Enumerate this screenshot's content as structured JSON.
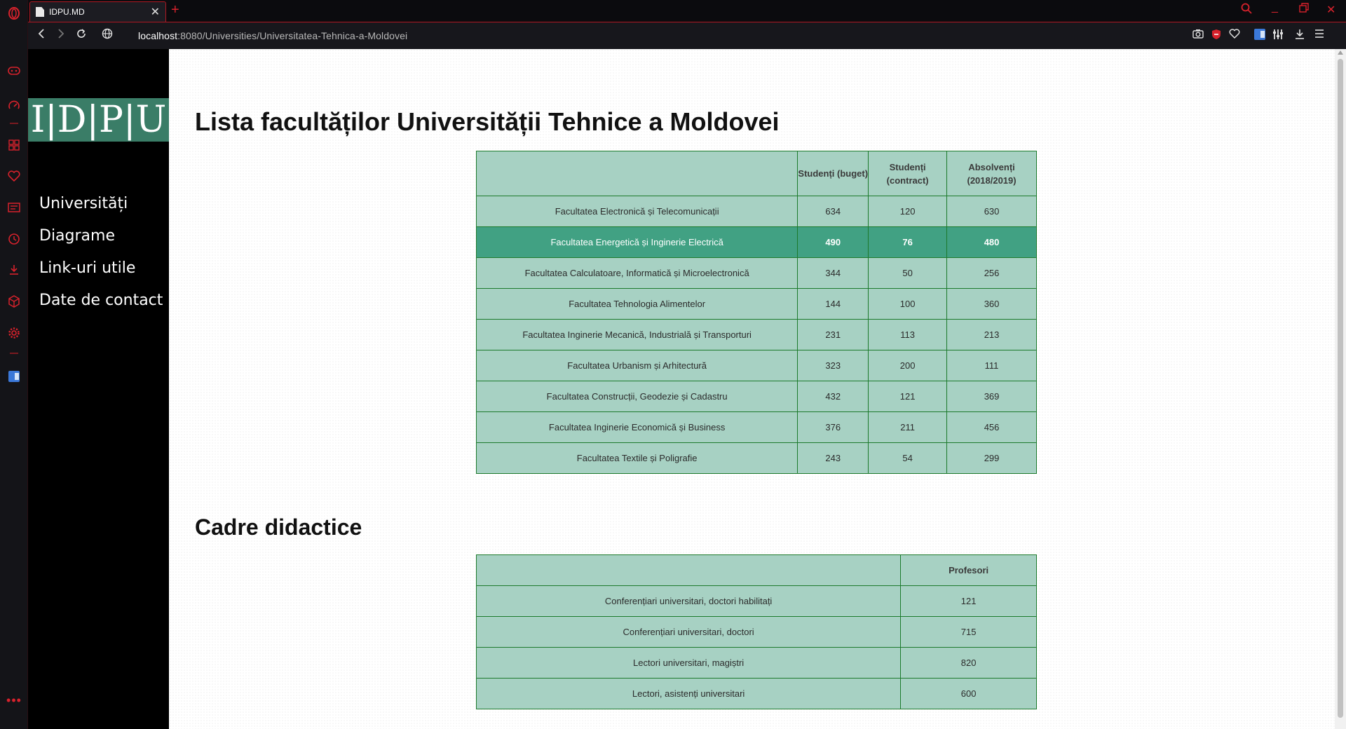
{
  "browser": {
    "tab_title": "IDPU.MD",
    "url_host": "localhost",
    "url_rest": ":8080/Universities/Universitatea-Tehnica-a-Moldovei",
    "accent": "#d8222c"
  },
  "sidebar": {
    "logo": "I|D|P|U",
    "logo_color": "#3a7d67",
    "items": [
      {
        "label": "Universități"
      },
      {
        "label": "Diagrame"
      },
      {
        "label": "Link-uri utile"
      },
      {
        "label": "Date de contact"
      }
    ]
  },
  "main": {
    "title": "Lista facultăților Universității Tehnice a Moldovei",
    "faculties_table": {
      "headers": [
        "",
        "Studenți (buget)",
        "Studenți (contract)",
        "Absolvenți (2018/2019)"
      ],
      "rows": [
        {
          "name": "Facultatea Electronică și Telecomunicații",
          "buget": "634",
          "contract": "120",
          "absolventi": "630"
        },
        {
          "name": "Facultatea Energetică și Inginerie Electrică",
          "buget": "490",
          "contract": "76",
          "absolventi": "480"
        },
        {
          "name": "Facultatea Calculatoare, Informatică și Microelectronică",
          "buget": "344",
          "contract": "50",
          "absolventi": "256"
        },
        {
          "name": "Facultatea Tehnologia Alimentelor",
          "buget": "144",
          "contract": "100",
          "absolventi": "360"
        },
        {
          "name": "Facultatea Inginerie Mecanică, Industrială și Transporturi",
          "buget": "231",
          "contract": "113",
          "absolventi": "213"
        },
        {
          "name": "Facultatea Urbanism și Arhitectură",
          "buget": "323",
          "contract": "200",
          "absolventi": "111"
        },
        {
          "name": "Facultatea Construcții, Geodezie și Cadastru",
          "buget": "432",
          "contract": "121",
          "absolventi": "369"
        },
        {
          "name": "Facultatea Inginerie Economică și Business",
          "buget": "376",
          "contract": "211",
          "absolventi": "456"
        },
        {
          "name": "Facultatea Textile și Poligrafie",
          "buget": "243",
          "contract": "54",
          "absolventi": "299"
        }
      ]
    },
    "staff_title": "Cadre didactice",
    "staff_table": {
      "headers": [
        "",
        "Profesori"
      ],
      "rows": [
        {
          "name": "Conferențiari universitari, doctori habilitați",
          "value": "121"
        },
        {
          "name": "Conferențiari universitari, doctori",
          "value": "715"
        },
        {
          "name": "Lectori universitari, magiștri",
          "value": "820"
        },
        {
          "name": "Lectori, asistenți universitari",
          "value": "600"
        }
      ]
    }
  }
}
